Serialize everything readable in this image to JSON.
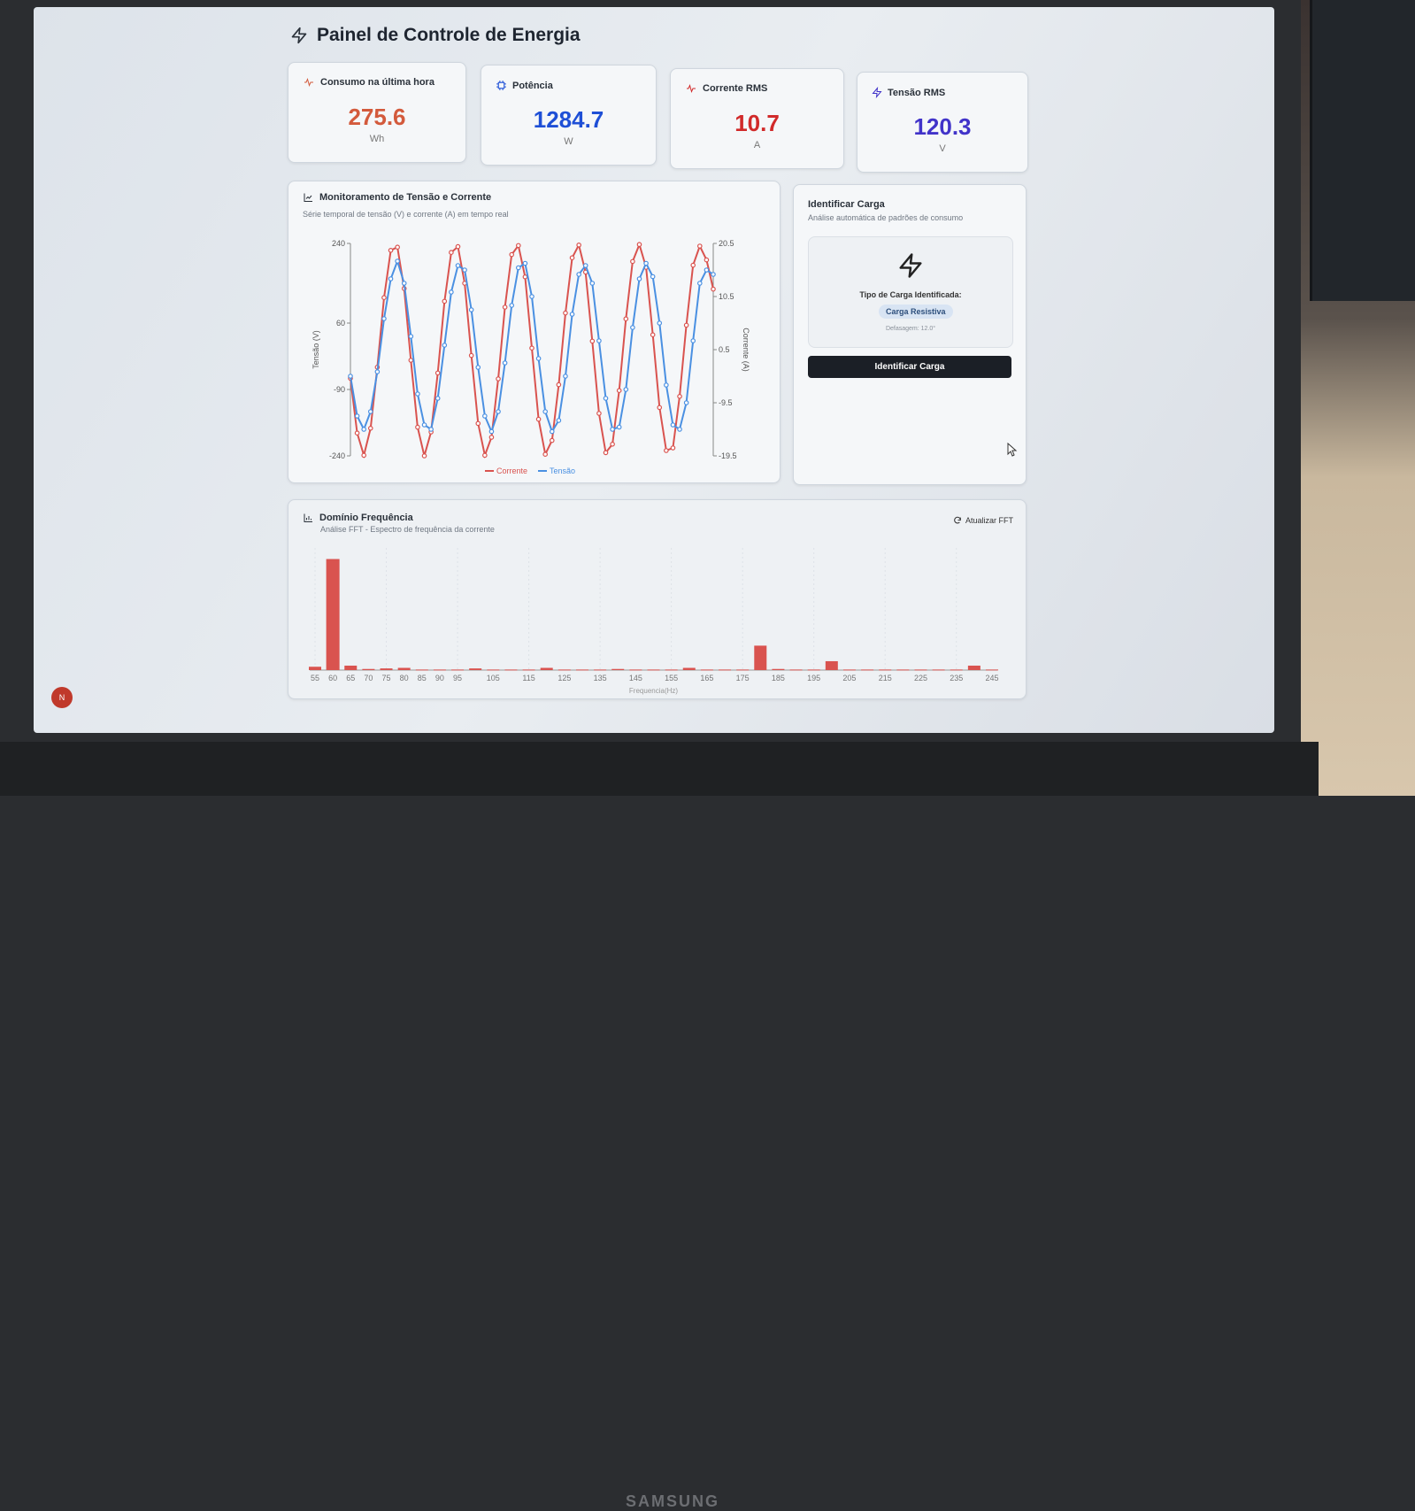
{
  "app": {
    "title": "Painel de Controle de Energia"
  },
  "metrics": [
    {
      "label": "Consumo na última hora",
      "value": "275.6",
      "unit": "Wh",
      "color": "#d35a3c",
      "icon": "pulse-icon"
    },
    {
      "label": "Potência",
      "value": "1284.7",
      "unit": "W",
      "color": "#1e4fd6",
      "icon": "cpu-icon"
    },
    {
      "label": "Corrente RMS",
      "value": "10.7",
      "unit": "A",
      "color": "#d12a2a",
      "icon": "pulse-icon"
    },
    {
      "label": "Tensão RMS",
      "value": "120.3",
      "unit": "V",
      "color": "#4133c9",
      "icon": "zap-icon"
    }
  ],
  "monitor": {
    "title": "Monitoramento de Tensão e Corrente",
    "subtitle": "Série temporal de tensão (V) e corrente (A) em tempo real",
    "legend": {
      "current": "Corrente",
      "voltage": "Tensão"
    }
  },
  "identify": {
    "title": "Identificar Carga",
    "subtitle": "Análise automática de padrões de consumo",
    "type_label": "Tipo de Carga Identificada:",
    "load_type": "Carga Resistiva",
    "phase": "Defasagem: 12.0°",
    "button_label": "Identificar Carga"
  },
  "freq": {
    "title": "Domínio Frequência",
    "subtitle": "Análise FFT - Espectro de frequência da corrente",
    "refresh_label": "Atualizar FFT"
  },
  "avatar": "N",
  "brand": "SAMSUNG",
  "chart_data": [
    {
      "type": "line",
      "title": "Monitoramento de Tensão e Corrente",
      "ylabel": "Tensão (V)",
      "y2label": "Corrente (A)",
      "ylim": [
        -240,
        240
      ],
      "y2lim": [
        -19.5,
        20.5
      ],
      "yticks": [
        "240",
        "60",
        "-90",
        "-240"
      ],
      "y2ticks": [
        "20.5",
        "10.5",
        "0.5",
        "-9.5",
        "-19.5"
      ],
      "legend_position": "bottom",
      "series": [
        {
          "name": "Corrente",
          "color": "#d9534f",
          "axis": "right",
          "values": [
            -4.9,
            -15.2,
            -19.4,
            -14.3,
            -2.8,
            10.3,
            19.2,
            19.8,
            12.0,
            -1.5,
            -14.1,
            -19.5,
            -15.0,
            -3.9,
            9.6,
            18.8,
            19.9,
            13.0,
            -0.6,
            -13.4,
            -19.4,
            -16.0,
            -5.0,
            8.5,
            18.4,
            20.1,
            14.2,
            0.8,
            -12.6,
            -19.2,
            -16.6,
            -6.1,
            7.4,
            17.8,
            20.2,
            15.1,
            2.1,
            -11.5,
            -18.9,
            -17.3,
            -7.2,
            6.3,
            17.1,
            20.3,
            16.0,
            3.3,
            -10.4,
            -18.5,
            -18.0,
            -8.3,
            5.1,
            16.4,
            20.0,
            17.4,
            11.9
          ]
        },
        {
          "name": "Tensão",
          "color": "#4a90e2",
          "axis": "left",
          "values": [
            -60,
            -150,
            -180,
            -140,
            -50,
            70,
            160,
            200,
            150,
            30,
            -100,
            -170,
            -180,
            -110,
            10,
            130,
            190,
            180,
            90,
            -40,
            -150,
            -185,
            -140,
            -30,
            100,
            185,
            195,
            120,
            -20,
            -140,
            -185,
            -160,
            -60,
            80,
            170,
            190,
            150,
            20,
            -110,
            -180,
            -175,
            -90,
            50,
            160,
            195,
            165,
            60,
            -80,
            -170,
            -180,
            -120,
            20,
            150,
            180,
            170
          ]
        }
      ]
    },
    {
      "type": "bar",
      "title": "Domínio Frequência",
      "xlabel": "Frequencia(Hz)",
      "categories": [
        "55",
        "60",
        "65",
        "70",
        "75",
        "80",
        "85",
        "90",
        "95",
        "100",
        "105",
        "110",
        "115",
        "120",
        "125",
        "130",
        "135",
        "140",
        "145",
        "150",
        "155",
        "160",
        "165",
        "170",
        "175",
        "180",
        "185",
        "190",
        "195",
        "200",
        "205",
        "210",
        "215",
        "220",
        "225",
        "230",
        "235",
        "240",
        "245"
      ],
      "xticks": [
        "55",
        "60",
        "65",
        "70",
        "75",
        "80",
        "85",
        "90",
        "95",
        "105",
        "115",
        "125",
        "135",
        "145",
        "155",
        "165",
        "175",
        "185",
        "195",
        "205",
        "215",
        "225",
        "235",
        "245"
      ],
      "values": [
        3,
        100,
        4,
        1,
        1.5,
        2,
        0.5,
        0.5,
        0.5,
        1.5,
        0.5,
        0.5,
        0.5,
        2,
        0.5,
        0.5,
        0.5,
        1,
        0.5,
        0.5,
        0.5,
        2,
        0.5,
        0.5,
        0.5,
        22,
        1,
        0.5,
        0.5,
        8,
        0.5,
        0.5,
        0.5,
        0.5,
        0.5,
        0.5,
        0.5,
        4,
        0.5
      ],
      "ylim": [
        0,
        110
      ],
      "bar_color": "#d9534f"
    }
  ]
}
